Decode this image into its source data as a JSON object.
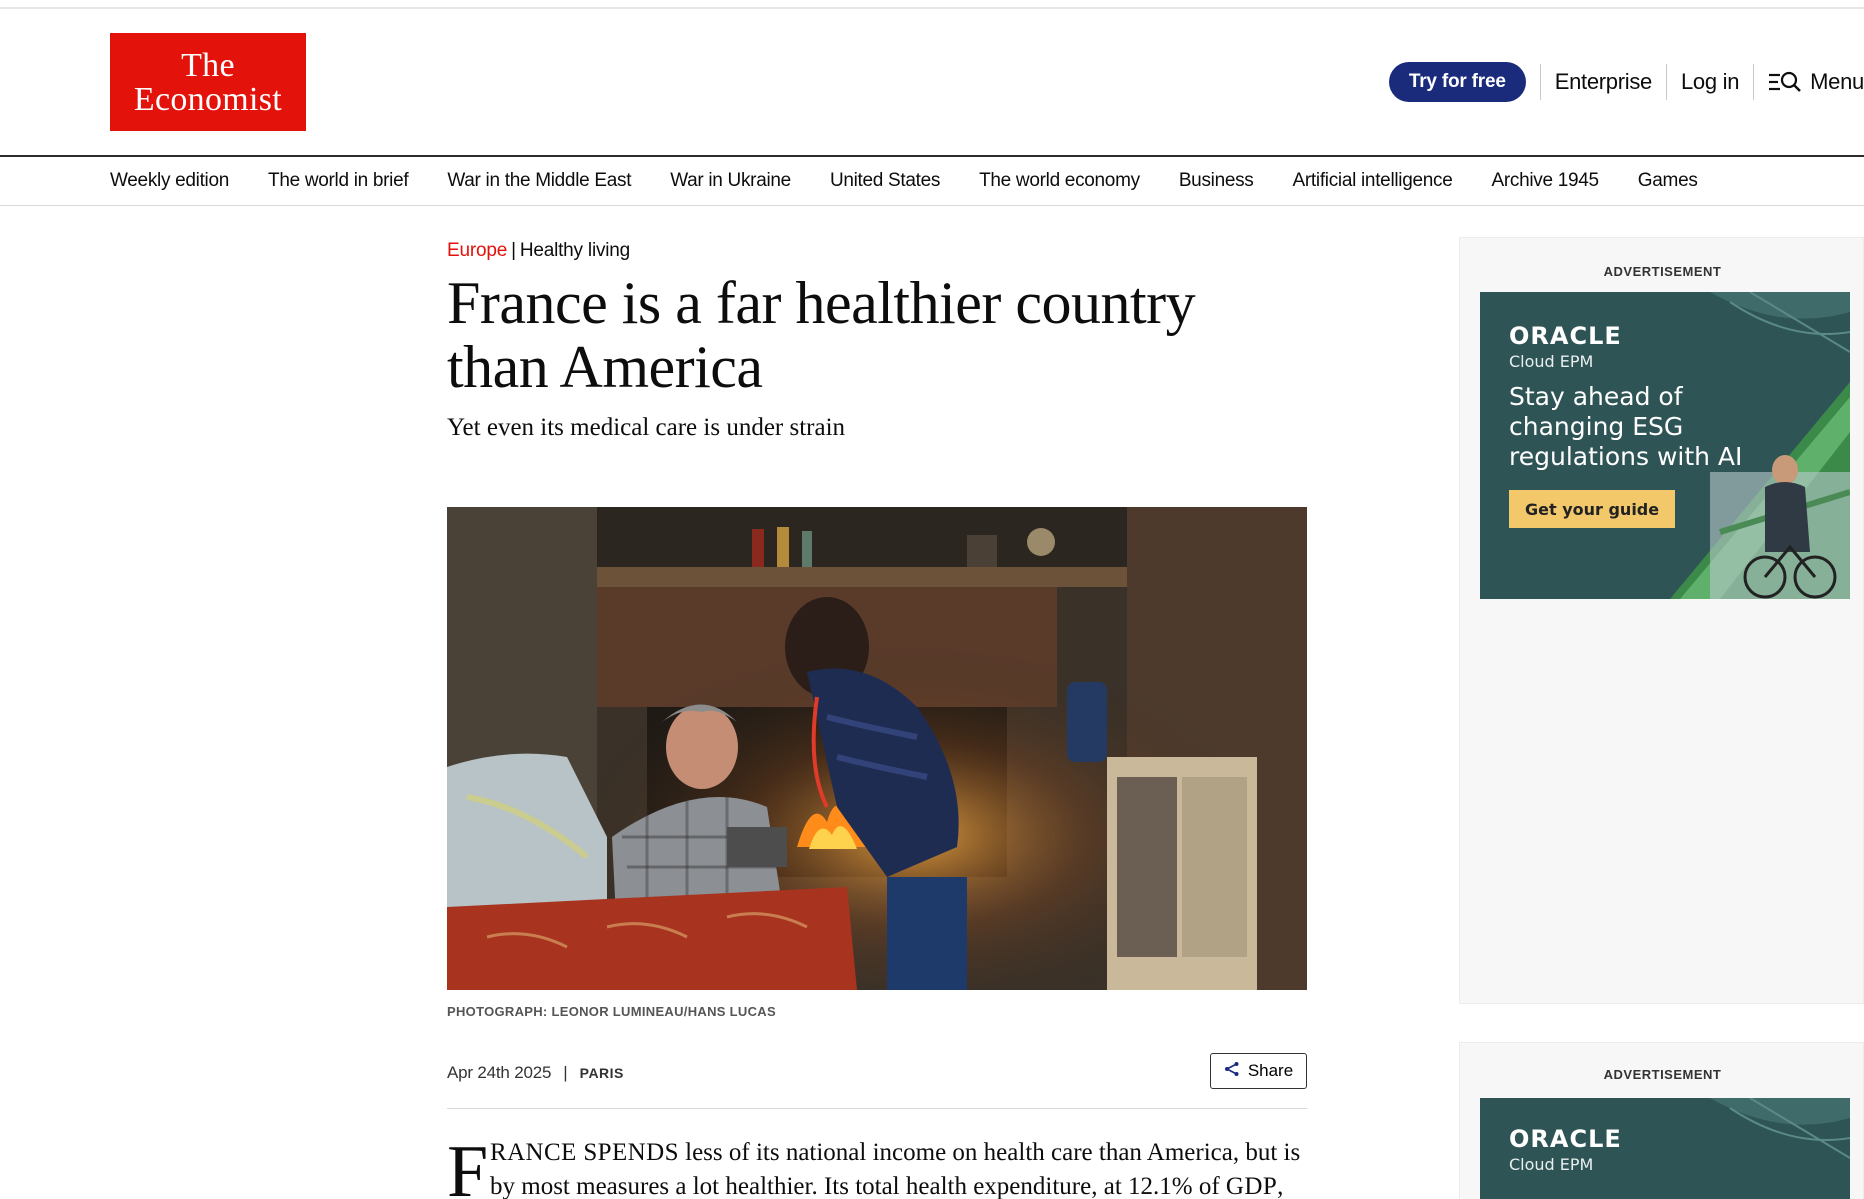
{
  "brand": {
    "logo_line1": "The",
    "logo_line2": "Economist",
    "accent": "#e3120b",
    "cta_color": "#1a2b7c"
  },
  "header": {
    "try_label": "Try for free",
    "enterprise_label": "Enterprise",
    "login_label": "Log in",
    "menu_label": "Menu"
  },
  "nav": {
    "items": [
      "Weekly edition",
      "The world in brief",
      "War in the Middle East",
      "War in Ukraine",
      "United States",
      "The world economy",
      "Business",
      "Artificial intelligence",
      "Archive 1945",
      "Games"
    ]
  },
  "article": {
    "section": "Europe",
    "topic": "Healthy living",
    "headline": "France is a far healthier country than America",
    "standfirst": "Yet even its medical care is under strain",
    "photo_credit": "PHOTOGRAPH: LEONOR LUMINEAU/HANS LUCAS",
    "date": "Apr 24th 2025",
    "location": "PARIS",
    "share_label": "Share",
    "dropcap": "F",
    "lead_smallcaps": "RANCE SPENDS",
    "line1_rest": " less of its national income on health care than America, but is",
    "line2_start": "by most measures a lot healthier. Its total health expenditure, at 12.1% of ",
    "line2_smallcaps": "GDP",
    "line2_end": ","
  },
  "ads": {
    "label": "ADVERTISEMENT",
    "brand": "ORACLE",
    "product": "Cloud EPM",
    "headline": "Stay ahead of changing ESG regulations with AI",
    "cta": "Get your guide",
    "bg_color": "#2f5456",
    "cta_color": "#f2c86b"
  },
  "icons": {
    "share": "share-icon",
    "menu": "menu-search-icon"
  }
}
